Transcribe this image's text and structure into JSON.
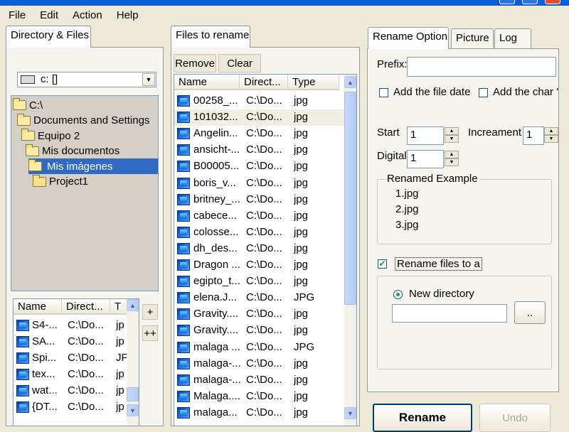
{
  "menu": [
    "File",
    "Edit",
    "Action",
    "Help"
  ],
  "left": {
    "tab_label": "Directory & Files",
    "drive": "c: []",
    "tree": [
      {
        "label": "C:\\",
        "depth": 0
      },
      {
        "label": "Documents and Settings",
        "depth": 1
      },
      {
        "label": "Equipo 2",
        "depth": 2
      },
      {
        "label": "Mis documentos",
        "depth": 3
      },
      {
        "label": "Mis imágenes",
        "depth": 4
      },
      {
        "label": "Project1",
        "depth": 5
      }
    ],
    "columns": [
      "Name",
      "Direct...",
      "T"
    ],
    "files": [
      {
        "name": "S4-...",
        "dir": "C:\\Do...",
        "type": "jp"
      },
      {
        "name": "SA...",
        "dir": "C:\\Do...",
        "type": "jp"
      },
      {
        "name": "Spi...",
        "dir": "C:\\Do...",
        "type": "JF"
      },
      {
        "name": "tex...",
        "dir": "C:\\Do...",
        "type": "jp"
      },
      {
        "name": "wat...",
        "dir": "C:\\Do...",
        "type": "jp"
      },
      {
        "name": "{DT...",
        "dir": "C:\\Do...",
        "type": "jp"
      }
    ],
    "add_label": "+",
    "add_all_label": "++"
  },
  "middle": {
    "tab_label": "Files to rename",
    "remove_label": "Remove",
    "clear_label": "Clear",
    "columns": [
      "Name",
      "Direct...",
      "Type"
    ],
    "files": [
      {
        "name": "00258_...",
        "dir": "C:\\Do...",
        "type": "jpg"
      },
      {
        "name": "101032...",
        "dir": "C:\\Do...",
        "type": "jpg"
      },
      {
        "name": "Angelin...",
        "dir": "C:\\Do...",
        "type": "jpg"
      },
      {
        "name": "ansicht-...",
        "dir": "C:\\Do...",
        "type": "jpg"
      },
      {
        "name": "B00005...",
        "dir": "C:\\Do...",
        "type": "jpg"
      },
      {
        "name": "boris_v...",
        "dir": "C:\\Do...",
        "type": "jpg"
      },
      {
        "name": "britney_...",
        "dir": "C:\\Do...",
        "type": "jpg"
      },
      {
        "name": "cabece...",
        "dir": "C:\\Do...",
        "type": "jpg"
      },
      {
        "name": "colosse...",
        "dir": "C:\\Do...",
        "type": "jpg"
      },
      {
        "name": "dh_des...",
        "dir": "C:\\Do...",
        "type": "jpg"
      },
      {
        "name": "Dragon ...",
        "dir": "C:\\Do...",
        "type": "jpg"
      },
      {
        "name": "egipto_t...",
        "dir": "C:\\Do...",
        "type": "jpg"
      },
      {
        "name": "elena.J...",
        "dir": "C:\\Do...",
        "type": "JPG"
      },
      {
        "name": "Gravity....",
        "dir": "C:\\Do...",
        "type": "jpg"
      },
      {
        "name": "Gravity....",
        "dir": "C:\\Do...",
        "type": "jpg"
      },
      {
        "name": "malaga ...",
        "dir": "C:\\Do...",
        "type": "JPG"
      },
      {
        "name": "malaga-...",
        "dir": "C:\\Do...",
        "type": "jpg"
      },
      {
        "name": "malaga-...",
        "dir": "C:\\Do...",
        "type": "jpg"
      },
      {
        "name": "Malaga....",
        "dir": "C:\\Do...",
        "type": "jpg"
      },
      {
        "name": "malaga...",
        "dir": "C:\\Do...",
        "type": "jpg"
      }
    ]
  },
  "right": {
    "tabs": [
      "Rename Option",
      "Picture",
      "Log"
    ],
    "prefix_label": "Prefix:",
    "prefix_value": "",
    "add_date_label": "Add the file date",
    "add_char_label": "Add the char '-",
    "start_label": "Start",
    "start_value": "1",
    "increment_label": "Increament",
    "increment_value": "1",
    "digital_label": "Digital",
    "digital_value": "1",
    "example_title": "Renamed Example",
    "examples": [
      "1.jpg",
      "2.jpg",
      "3.jpg"
    ],
    "rename_to_label": "Rename files to a",
    "new_dir_label": "New directory",
    "new_dir_value": "",
    "browse_label": "..",
    "rename_label": "Rename",
    "undo_label": "Undo"
  }
}
